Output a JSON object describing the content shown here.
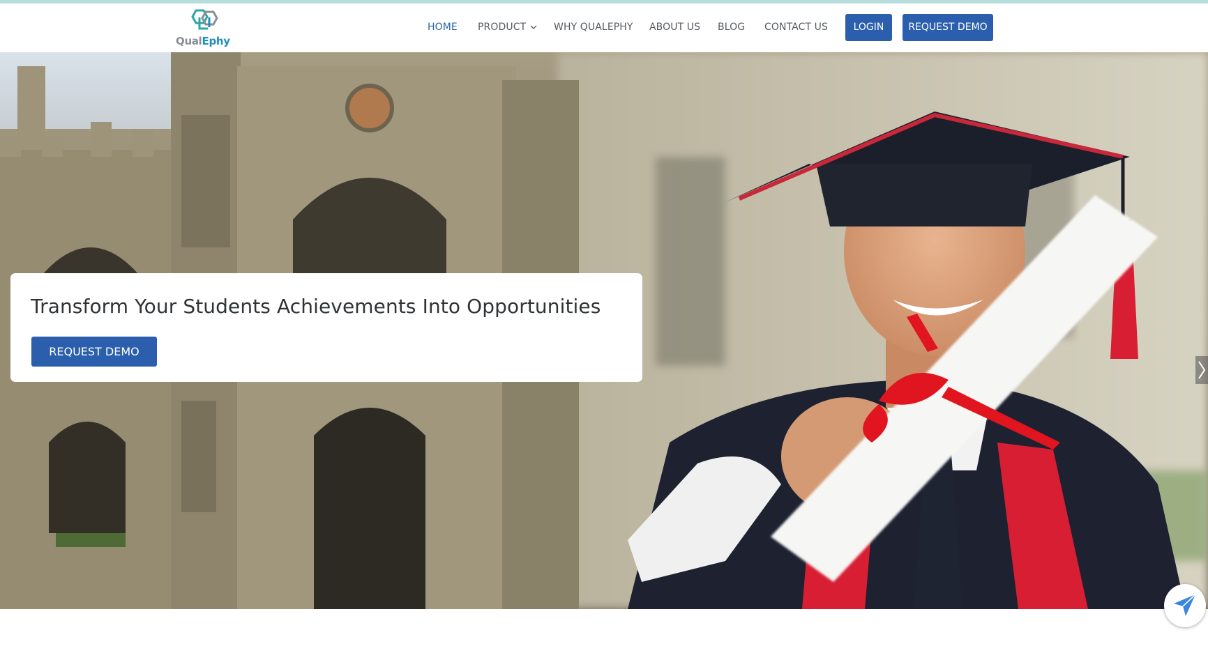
{
  "brand": {
    "logo_text_part1": "Qual",
    "logo_text_part2": "Ephy",
    "logo_icon": "hexagon-q-logo-icon",
    "colors": {
      "teal": "#2aa6a8",
      "blue": "#1f8fc0",
      "grey": "#8a8f93"
    }
  },
  "nav": {
    "items": [
      {
        "label": "HOME",
        "active": true
      },
      {
        "label": "PRODUCT",
        "has_dropdown": true,
        "icon": "chevron-down-icon"
      },
      {
        "label": "WHY QUALEPHY"
      },
      {
        "label": "ABOUT US"
      },
      {
        "label": "BLOG"
      },
      {
        "label": "CONTACT US"
      }
    ],
    "login_label": "LOGIN",
    "request_demo_label": "REQUEST DEMO",
    "active_color": "#2a63a8",
    "button_color": "#2b5fad"
  },
  "hero": {
    "headline": "Transform Your Students Achievements Into Opportunities",
    "cta_label": "REQUEST DEMO",
    "next_icon": "chevron-right-icon",
    "background": "graduate holding diploma in front of gothic college building"
  },
  "floating": {
    "icon": "paper-plane-icon"
  }
}
